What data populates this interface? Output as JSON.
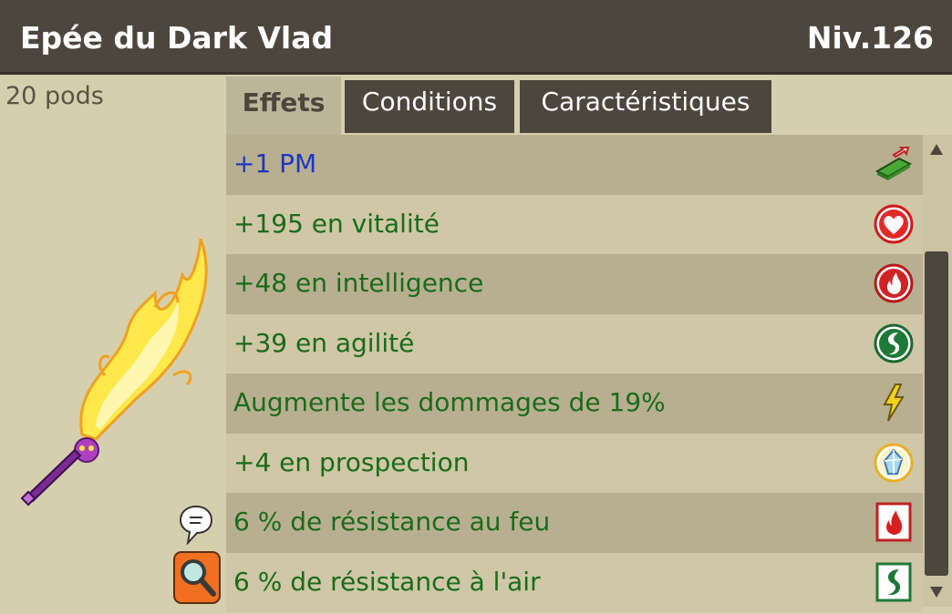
{
  "window": {
    "title": "Epée du Dark Vlad",
    "level": "Niv.126"
  },
  "item": {
    "weight": "20 pods",
    "image_icon": "flaming-sword-icon"
  },
  "tabs": [
    {
      "label": "Effets",
      "active": true
    },
    {
      "label": "Conditions",
      "active": false
    },
    {
      "label": "Caractéristiques",
      "active": false
    }
  ],
  "effects": [
    {
      "text": "+1 PM",
      "icon": "movement-points-icon",
      "color": "#1a38c4"
    },
    {
      "text": "+195 en vitalité",
      "icon": "heart-icon",
      "color": "#1a6b1a"
    },
    {
      "text": "+48 en intelligence",
      "icon": "fire-icon",
      "color": "#1a6b1a"
    },
    {
      "text": "+39 en agilité",
      "icon": "air-icon",
      "color": "#1a6b1a"
    },
    {
      "text": "Augmente les dommages de 19%",
      "icon": "lightning-icon",
      "color": "#1a6b1a"
    },
    {
      "text": "+4 en prospection",
      "icon": "crystal-icon",
      "color": "#1a6b1a"
    },
    {
      "text": "6 % de résistance au feu",
      "icon": "fire-resistance-icon",
      "color": "#1a6b1a"
    },
    {
      "text": "6 % de résistance à l'air",
      "icon": "air-resistance-icon",
      "color": "#1a6b1a"
    }
  ],
  "side_buttons": {
    "chat_icon": "speech-bubble-icon",
    "search_icon": "magnifier-icon"
  },
  "colors": {
    "header": "#4d463c",
    "panel": "#d6cfae",
    "row_dark": "#b8af90",
    "row_light": "#cfc7a5",
    "effect_green": "#1a6b1a",
    "effect_blue": "#1a38c4"
  }
}
